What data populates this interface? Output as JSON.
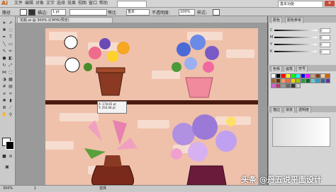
{
  "app": {
    "logo": "Ai"
  },
  "menu": {
    "items": [
      "文件",
      "编辑",
      "对象",
      "文字",
      "选择",
      "效果",
      "视图",
      "窗口",
      "帮助"
    ],
    "brush_label": "基本",
    "workspace": "基本功能"
  },
  "control_bar": {
    "mode": "路径",
    "stroke_label": "描边:",
    "stroke_weight": "1 pt",
    "style_label": "等比",
    "brush": "基本",
    "opacity_label": "不透明度:",
    "opacity": "100%",
    "style2": "样式:"
  },
  "document": {
    "tab": "花瓶.ai @ 300% (CMYK/预览)"
  },
  "panels": {
    "color_tabs": [
      "颜色",
      "颜色参考"
    ],
    "swatch_tabs": [
      "色板",
      "画笔",
      "符号"
    ],
    "stroke_tabs": [
      "描边",
      "渐变",
      "透明度"
    ],
    "sliders": [
      {
        "label": "C",
        "value": "0"
      },
      {
        "label": "M",
        "value": "0"
      },
      {
        "label": "Y",
        "value": "0"
      },
      {
        "label": "K",
        "value": "0"
      }
    ],
    "swatch_colors": [
      "#ffffff",
      "#000000",
      "#ff0000",
      "#ffff00",
      "#00ff00",
      "#00ffff",
      "#0000ff",
      "#ff00ff",
      "#c8a080",
      "#804020",
      "#ffcc99",
      "#cc6600",
      "#996633",
      "#663300",
      "#ff9966",
      "#ff6633",
      "#ffcc00",
      "#99cc00",
      "#339933",
      "#006633",
      "#66cccc",
      "#3399cc",
      "#336699",
      "#663399",
      "#cc66cc",
      "#cc3366",
      "#999999",
      "#666666",
      "#333333",
      "#cccccc"
    ]
  },
  "canvas": {
    "tooltip_lines": [
      "X: 178.65 pt",
      "Y: 350.08 pt"
    ]
  },
  "status": {
    "zoom": "300%",
    "page": "1",
    "tool": "选择"
  },
  "watermark": {
    "left": "知乎",
    "right": "头条 @丹五说平面设计"
  }
}
